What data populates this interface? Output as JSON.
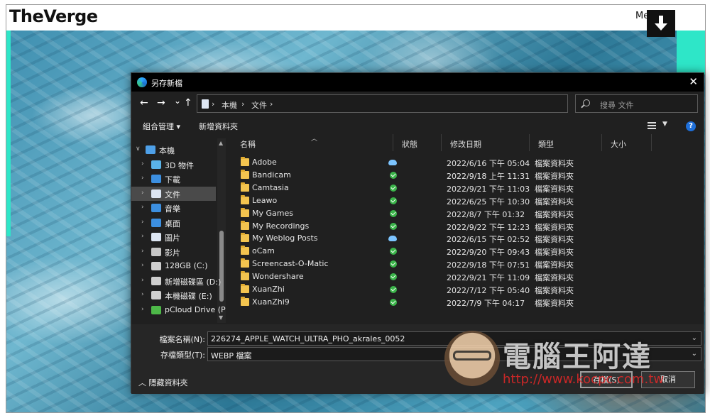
{
  "site": {
    "logo": "TheVerge",
    "menu": "Me"
  },
  "dialog": {
    "title": "另存新檔",
    "nav": {
      "back": "←",
      "forward": "→",
      "recent": "⌄",
      "up": "↑"
    },
    "address": {
      "crumbs": [
        "本機",
        "文件"
      ],
      "sep": "›"
    },
    "search": {
      "placeholder": "搜尋 文件"
    },
    "commands": {
      "organize": "組合管理 ▾",
      "new_folder": "新增資料夾"
    },
    "help": "?",
    "tree": [
      {
        "label": "本機",
        "icon": "computer-icon",
        "expanded": true
      },
      {
        "label": "3D 物件",
        "icon": "cube-icon"
      },
      {
        "label": "下載",
        "icon": "download-icon"
      },
      {
        "label": "文件",
        "icon": "document-icon",
        "selected": true
      },
      {
        "label": "音樂",
        "icon": "music-icon"
      },
      {
        "label": "桌面",
        "icon": "desktop-icon"
      },
      {
        "label": "圖片",
        "icon": "pictures-icon"
      },
      {
        "label": "影片",
        "icon": "video-icon"
      },
      {
        "label": "128GB (C:)",
        "icon": "drive-icon"
      },
      {
        "label": "新增磁碟區 (D:)",
        "icon": "drive-icon"
      },
      {
        "label": "本機磁碟 (E:)",
        "icon": "drive-icon"
      },
      {
        "label": "pCloud Drive (P",
        "icon": "cloud-drive-icon"
      }
    ],
    "columns": [
      "名稱",
      "狀態",
      "修改日期",
      "類型",
      "大小"
    ],
    "files": [
      {
        "name": "Adobe",
        "status": "cloud",
        "date": "2022/6/16 下午 05:04",
        "type": "檔案資料夾"
      },
      {
        "name": "Bandicam",
        "status": "ok",
        "date": "2022/9/18 上午 11:31",
        "type": "檔案資料夾"
      },
      {
        "name": "Camtasia",
        "status": "ok",
        "date": "2022/9/21 下午 11:03",
        "type": "檔案資料夾"
      },
      {
        "name": "Leawo",
        "status": "ok",
        "date": "2022/6/25 下午 10:30",
        "type": "檔案資料夾"
      },
      {
        "name": "My Games",
        "status": "ok",
        "date": "2022/8/7 下午 01:32",
        "type": "檔案資料夾"
      },
      {
        "name": "My Recordings",
        "status": "ok",
        "date": "2022/9/22 下午 12:23",
        "type": "檔案資料夾"
      },
      {
        "name": "My Weblog Posts",
        "status": "cloud",
        "date": "2022/6/15 下午 02:52",
        "type": "檔案資料夾"
      },
      {
        "name": "oCam",
        "status": "ok",
        "date": "2022/9/20 下午 09:43",
        "type": "檔案資料夾"
      },
      {
        "name": "Screencast-O-Matic",
        "status": "ok",
        "date": "2022/9/18 下午 07:51",
        "type": "檔案資料夾"
      },
      {
        "name": "Wondershare",
        "status": "ok",
        "date": "2022/9/21 下午 11:09",
        "type": "檔案資料夾"
      },
      {
        "name": "XuanZhi",
        "status": "ok",
        "date": "2022/7/12 下午 05:40",
        "type": "檔案資料夾"
      },
      {
        "name": "XuanZhi9",
        "status": "ok",
        "date": "2022/7/9 下午 04:17",
        "type": "檔案資料夾"
      }
    ],
    "filename": {
      "label": "檔案名稱(N):",
      "value": "226274_APPLE_WATCH_ULTRA_PHO_akrales_0052"
    },
    "filetype": {
      "label": "存檔類型(T):",
      "value": "WEBP 檔案"
    },
    "hide_folders": "隱藏資料夾",
    "save": "存檔(S)",
    "cancel": "取消"
  },
  "watermark": {
    "title": "電腦王阿達",
    "url": "http://www.kocpc.com.tw"
  },
  "colors": {
    "teal": "#2ee6c8",
    "folder": "#f3c44f",
    "status_ok": "#3bb54a",
    "status_cloud": "#7cc4ff"
  }
}
